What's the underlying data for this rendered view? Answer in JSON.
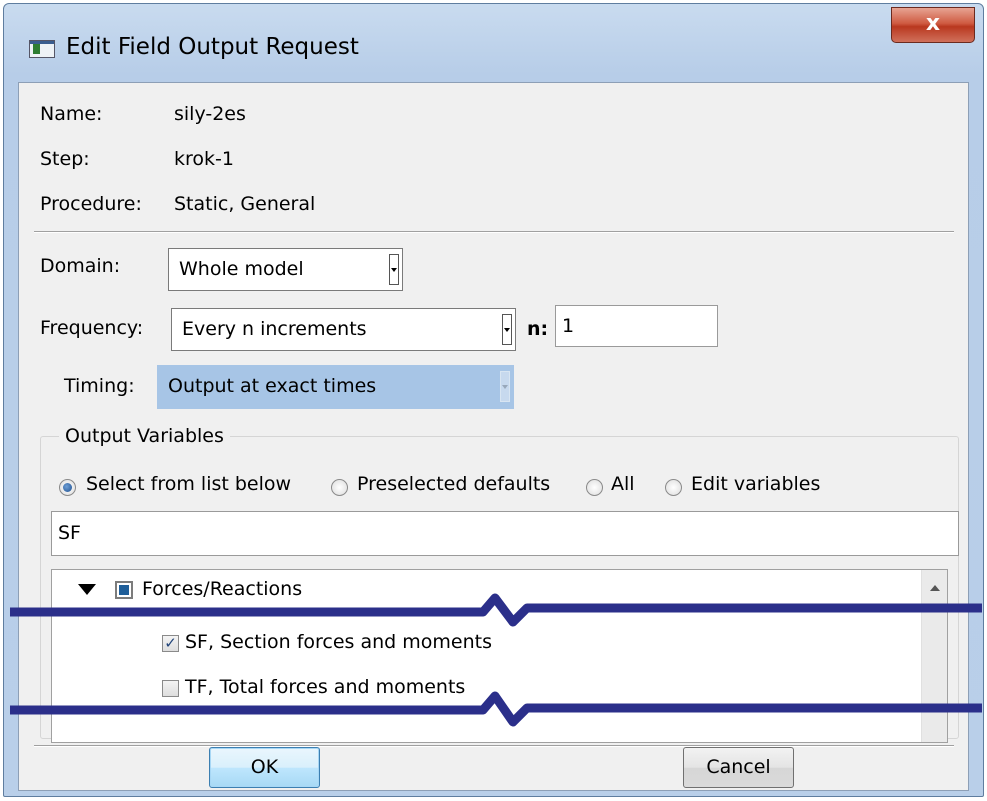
{
  "window": {
    "title": "Edit Field Output Request",
    "close_label": "x"
  },
  "info": {
    "name_label": "Name:",
    "name_value": "sily-2es",
    "step_label": "Step:",
    "step_value": "krok-1",
    "procedure_label": "Procedure:",
    "procedure_value": "Static, General"
  },
  "domain": {
    "label": "Domain:",
    "value": "Whole model"
  },
  "frequency": {
    "label": "Frequency:",
    "value": "Every n increments",
    "n_label": "n:",
    "n_value": "1"
  },
  "timing": {
    "label": "Timing:",
    "value": "Output at exact times"
  },
  "output_variables": {
    "group_label": "Output Variables",
    "radio_options": [
      "Select from list below",
      "Preselected defaults",
      "All",
      "Edit variables"
    ],
    "selected_option": "Select from list below",
    "filter_text": "SF",
    "tree": {
      "category": "Forces/Reactions",
      "items": [
        {
          "label": "SF, Section forces and moments",
          "checked": true
        },
        {
          "label": "TF, Total forces and moments",
          "checked": false
        }
      ]
    }
  },
  "buttons": {
    "ok": "OK",
    "cancel": "Cancel"
  },
  "colors": {
    "break_line": "#2b2f8a",
    "selection_highlight": "#a7c5e6"
  }
}
